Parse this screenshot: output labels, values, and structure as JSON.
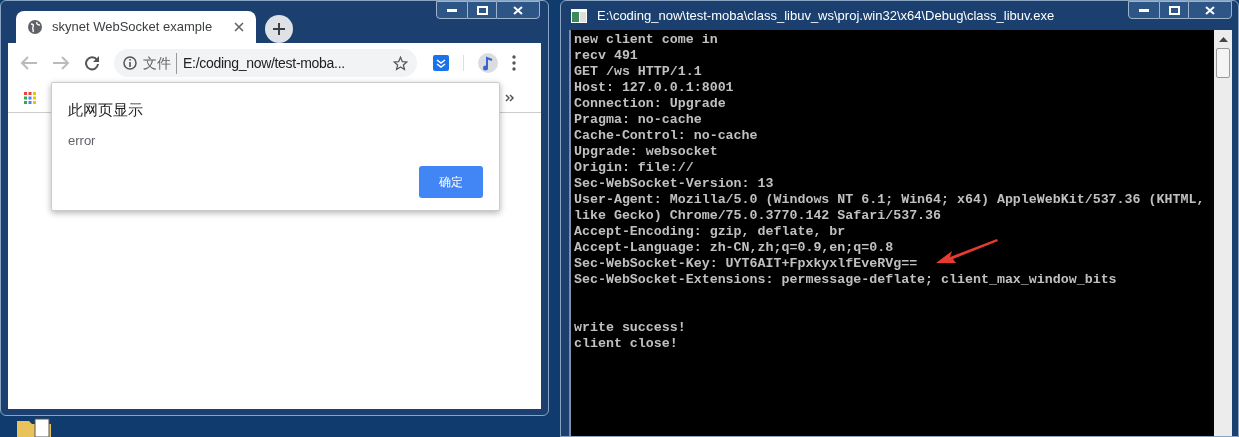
{
  "browser": {
    "tab": {
      "title": "skynet WebSocket example",
      "selected": true
    },
    "omnibox": {
      "security_label": "文件",
      "url": "E:/coding_now/test-moba..."
    },
    "dialog": {
      "title": "此网页显示",
      "message": "error",
      "button": "确定"
    }
  },
  "console": {
    "title": "E:\\coding_now\\test-moba\\class_libuv_ws\\proj.win32\\x64\\Debug\\class_libuv.exe",
    "blocks": [
      [
        "new client come in",
        "recv 491",
        "GET /ws HTTP/1.1",
        "Host: 127.0.0.1:8001",
        "Connection: Upgrade",
        "Pragma: no-cache",
        "Cache-Control: no-cache",
        "Upgrade: websocket",
        "Origin: file://",
        "Sec-WebSocket-Version: 13",
        "User-Agent: Mozilla/5.0 (Windows NT 6.1; Win64; x64) AppleWebKit/537.36 (KHTML,",
        "like Gecko) Chrome/75.0.3770.142 Safari/537.36",
        "Accept-Encoding: gzip, deflate, br",
        "Accept-Language: zh-CN,zh;q=0.9,en;q=0.8",
        "Sec-WebSocket-Key: UYT6AIT+FpxkyxlfEveRVg==",
        "Sec-WebSocket-Extensions: permessage-deflate; client_max_window_bits"
      ],
      [
        "write success!",
        "client close!"
      ]
    ]
  }
}
